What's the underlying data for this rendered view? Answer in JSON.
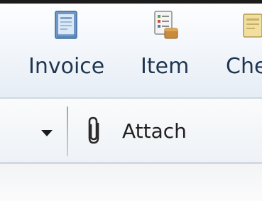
{
  "ribbon": {
    "buttons": [
      {
        "label": "Invoice",
        "icon": "invoice-icon"
      },
      {
        "label": "Item",
        "icon": "item-icon"
      },
      {
        "label": "Che",
        "icon": "check-icon"
      }
    ]
  },
  "toolbar": {
    "attach_label": "Attach",
    "attach_icon": "paperclip-icon",
    "dropdown_icon": "dropdown-arrow-icon"
  }
}
